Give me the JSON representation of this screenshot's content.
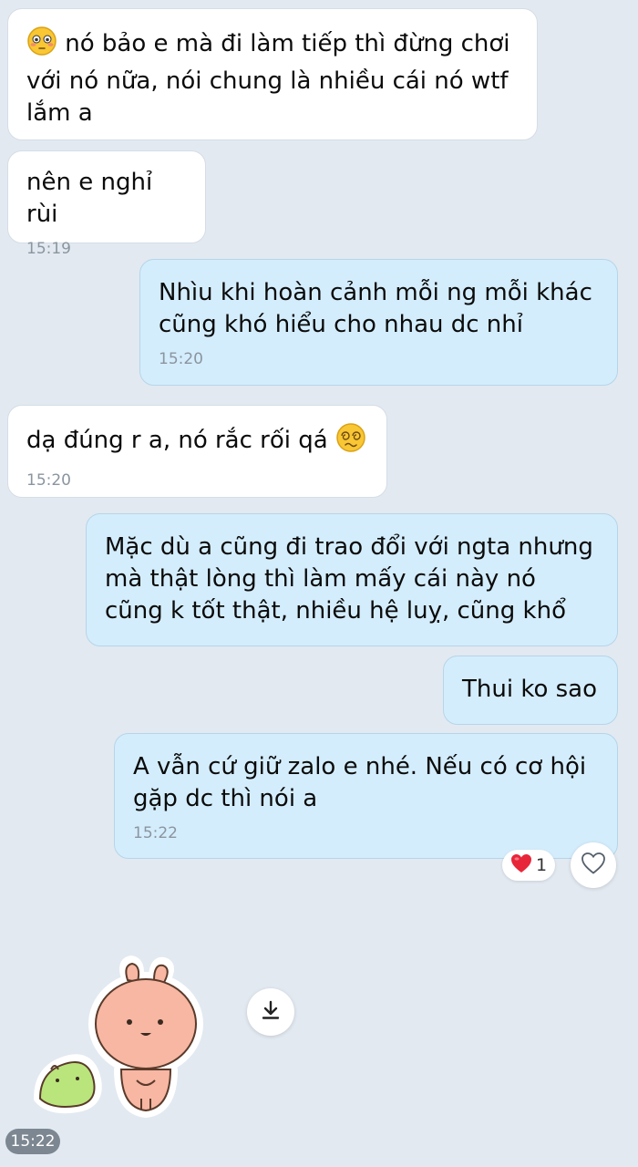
{
  "messages": [
    {
      "direction": "in",
      "text": "nó bảo e mà đi làm tiếp thì đừng chơi với nó nữa, nói chung là nhiều cái nó wtf lắm a",
      "leading_emoji": "flushed-face",
      "time": ""
    },
    {
      "direction": "in",
      "text": "nên e nghỉ rùi",
      "time": "15:19"
    },
    {
      "direction": "out",
      "text": "Nhìu khi hoàn cảnh mỗi ng mỗi khác cũng khó hiểu cho nhau dc nhỉ",
      "time": "15:20"
    },
    {
      "direction": "in",
      "text": "dạ đúng r a, nó rắc rối qá",
      "trailing_emoji": "dizzy-face",
      "time": "15:20"
    },
    {
      "direction": "out",
      "text": "Mặc dù a cũng đi trao đổi với ngta nhưng mà thật lòng thì làm mấy cái này nó cũng k tốt thật, nhiều hệ luỵ, cũng khổ",
      "time": ""
    },
    {
      "direction": "out",
      "text": "Thui ko sao",
      "time": ""
    },
    {
      "direction": "out",
      "text": "A vẫn cứ giữ zalo e nhé. Nếu có cơ hội gặp dc thì nói a",
      "time": "15:22"
    }
  ],
  "reaction": {
    "icon": "red-heart",
    "count": "1"
  },
  "react_button_icon": "heart-outline-icon",
  "sticker": {
    "description_icon": "bunny-and-snake-sticker",
    "time": "15:22",
    "download_icon": "download-icon"
  },
  "colors": {
    "background": "#e2e9f1",
    "incoming": "#ffffff",
    "outgoing": "#d4edfc",
    "heart": "#e8263a"
  }
}
